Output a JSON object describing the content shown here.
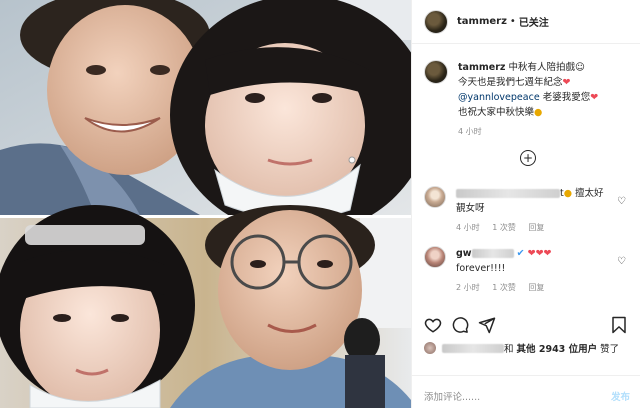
{
  "post": {
    "username": "tammerz",
    "follow_separator": "•",
    "follow_status": "已关注",
    "caption_line1": "中秋有人陪拍戲☺",
    "caption_line2": "今天也是我們七週年紀念",
    "caption_mention": "@yannlovepeace",
    "caption_line3_suffix": " 老婆我愛您",
    "caption_line4": "也祝大家中秋快樂",
    "caption_time": "4 小时",
    "add_more_symbol": "+"
  },
  "comments": [
    {
      "text_end": "t",
      "text_after_emoji": " 擅太好",
      "text_line2": "靚女呀",
      "time": "4 小时",
      "likes": "1 次赞",
      "reply": "回复"
    },
    {
      "name_suffix": "",
      "hearts": "❤❤❤",
      "text": "forever!!!!",
      "time": "2 小时",
      "likes": "1 次赞",
      "reply": "回复"
    }
  ],
  "likes_line": {
    "name_suffix": "和",
    "others": "其他 2943 位用户",
    "liked": "赞了"
  },
  "composer": {
    "placeholder": "添加评论......",
    "post_label": "发布"
  },
  "icons": {
    "like": "heart-icon",
    "comment": "comment-icon",
    "share": "share-icon",
    "save": "bookmark-icon",
    "comment_like": "heart-outline-icon",
    "verified": "verified-badge-icon"
  },
  "colors": {
    "mention": "#00376b",
    "heart": "#ed4956",
    "muted": "#8e8e8e",
    "post_button": "#b2dffc"
  }
}
